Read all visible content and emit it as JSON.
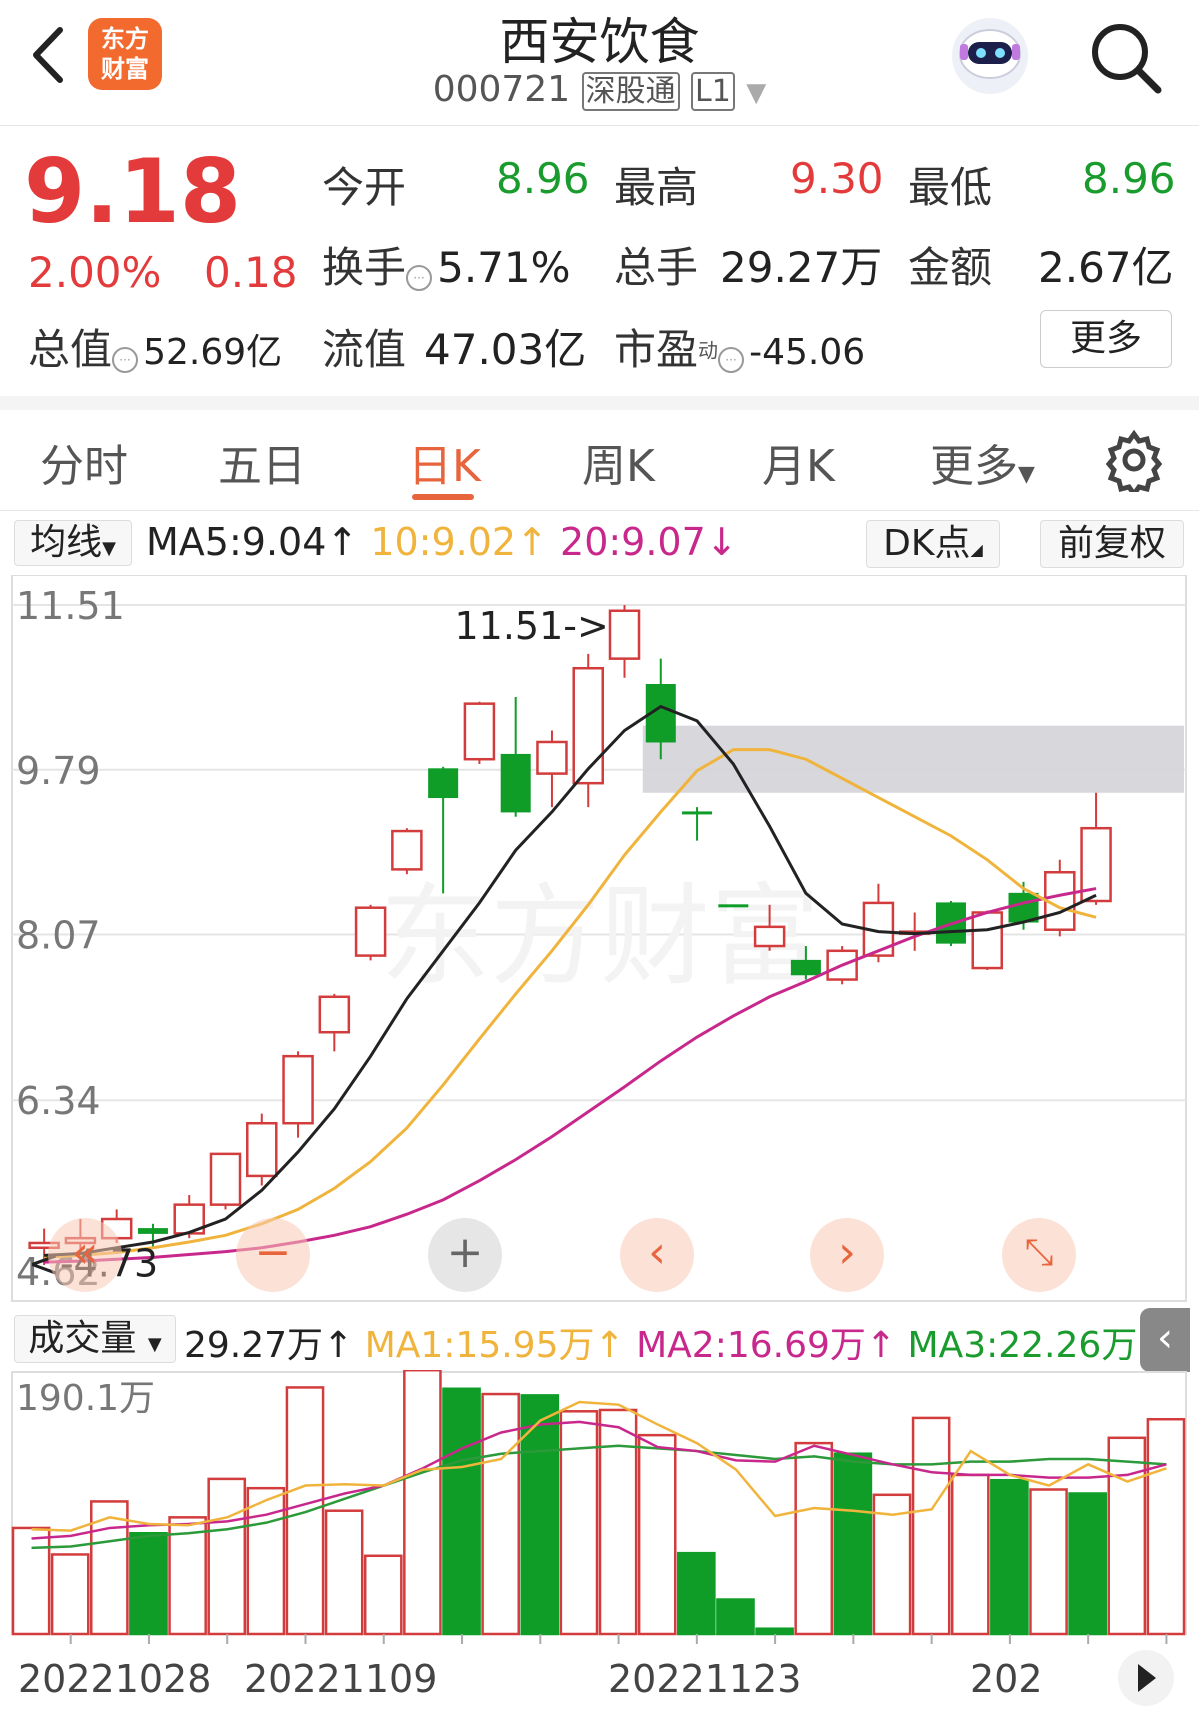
{
  "header": {
    "logo_line1": "东方",
    "logo_line2": "财富",
    "title": "西安饮食",
    "code": "000721",
    "tag1": "深股通",
    "tag2": "L1"
  },
  "quote": {
    "price": "9.18",
    "change_pct": "2.00%",
    "change": "0.18",
    "open_label": "今开",
    "open": "8.96",
    "high_label": "最高",
    "high": "9.30",
    "low_label": "最低",
    "low": "8.96",
    "turnover_label": "换手",
    "turnover": "5.71%",
    "volume_label": "总手",
    "volume": "29.27万",
    "amount_label": "金额",
    "amount": "2.67亿",
    "mktcap_label": "总值",
    "mktcap": "52.69亿",
    "float_label": "流值",
    "float_cap": "47.03亿",
    "pe_label": "市盈",
    "pe_sup": "动",
    "pe": "-45.06",
    "more_button": "更多"
  },
  "tabs": [
    "分时",
    "五日",
    "日K",
    "周K",
    "月K",
    "更多"
  ],
  "active_tab": "日K",
  "ma_bar": {
    "selector": "均线",
    "ma5": "MA5:9.04",
    "ma10": "10:9.02",
    "ma20": "20:9.07",
    "dk_button": "DK点",
    "fq_button": "前复权"
  },
  "vol_bar": {
    "selector": "成交量",
    "vol": "29.27万",
    "ma1": "MA1:15.95万",
    "ma2": "MA2:16.69万",
    "ma3": "MA3:22.26万"
  },
  "colors": {
    "up": "#d23c3c",
    "down": "#0f9d28",
    "ma5": "#222222",
    "ma10": "#f0b43c",
    "ma20": "#c8288c",
    "accent": "#e8643c"
  },
  "chart_data": {
    "type": "candlestick",
    "y_ticks": [
      "11.51",
      "9.79",
      "8.07",
      "6.34",
      "4.62"
    ],
    "ylim": [
      4.62,
      11.51
    ],
    "max_label": "11.51",
    "min_label": "4.73",
    "watermark": "东方财富",
    "candles": [
      {
        "o": 4.8,
        "c": 4.85,
        "h": 5.0,
        "l": 4.62,
        "dir": "up"
      },
      {
        "o": 4.85,
        "c": 4.9,
        "h": 5.1,
        "l": 4.78,
        "dir": "up"
      },
      {
        "o": 4.9,
        "c": 5.1,
        "h": 5.2,
        "l": 4.85,
        "dir": "up"
      },
      {
        "o": 5.0,
        "c": 4.95,
        "h": 5.05,
        "l": 4.8,
        "dir": "down"
      },
      {
        "o": 4.95,
        "c": 5.25,
        "h": 5.35,
        "l": 4.9,
        "dir": "up"
      },
      {
        "o": 5.25,
        "c": 5.78,
        "h": 5.78,
        "l": 5.2,
        "dir": "up"
      },
      {
        "o": 5.55,
        "c": 6.1,
        "h": 6.2,
        "l": 5.45,
        "dir": "up"
      },
      {
        "o": 6.1,
        "c": 6.8,
        "h": 6.85,
        "l": 5.95,
        "dir": "up"
      },
      {
        "o": 7.05,
        "c": 7.42,
        "h": 7.45,
        "l": 6.85,
        "dir": "up"
      },
      {
        "o": 7.85,
        "c": 8.35,
        "h": 8.38,
        "l": 7.8,
        "dir": "up"
      },
      {
        "o": 8.75,
        "c": 9.15,
        "h": 9.18,
        "l": 8.7,
        "dir": "up"
      },
      {
        "o": 9.8,
        "c": 9.5,
        "h": 9.82,
        "l": 8.5,
        "dir": "down"
      },
      {
        "o": 9.9,
        "c": 10.48,
        "h": 10.5,
        "l": 9.85,
        "dir": "up"
      },
      {
        "o": 9.95,
        "c": 9.35,
        "h": 10.55,
        "l": 9.3,
        "dir": "down"
      },
      {
        "o": 9.75,
        "c": 10.08,
        "h": 10.2,
        "l": 9.4,
        "dir": "up"
      },
      {
        "o": 9.65,
        "c": 10.85,
        "h": 11.0,
        "l": 9.4,
        "dir": "up"
      },
      {
        "o": 10.95,
        "c": 11.45,
        "h": 11.51,
        "l": 10.75,
        "dir": "up"
      },
      {
        "o": 10.68,
        "c": 10.08,
        "h": 10.95,
        "l": 9.9,
        "dir": "down"
      },
      {
        "o": 9.35,
        "c": 9.35,
        "h": 9.4,
        "l": 9.05,
        "dir": "down"
      },
      {
        "o": 8.38,
        "c": 8.38,
        "h": 8.38,
        "l": 8.38,
        "dir": "down"
      },
      {
        "o": 7.95,
        "c": 8.15,
        "h": 8.38,
        "l": 7.9,
        "dir": "up"
      },
      {
        "o": 7.8,
        "c": 7.65,
        "h": 7.95,
        "l": 7.6,
        "dir": "down"
      },
      {
        "o": 7.6,
        "c": 7.9,
        "h": 7.95,
        "l": 7.55,
        "dir": "up"
      },
      {
        "o": 7.85,
        "c": 8.4,
        "h": 8.6,
        "l": 7.78,
        "dir": "up"
      },
      {
        "o": 8.1,
        "c": 8.1,
        "h": 8.3,
        "l": 7.9,
        "dir": "up"
      },
      {
        "o": 8.4,
        "c": 7.98,
        "h": 8.42,
        "l": 7.95,
        "dir": "down"
      },
      {
        "o": 7.72,
        "c": 8.3,
        "h": 8.32,
        "l": 7.7,
        "dir": "up"
      },
      {
        "o": 8.5,
        "c": 8.2,
        "h": 8.62,
        "l": 8.12,
        "dir": "down"
      },
      {
        "o": 8.12,
        "c": 8.72,
        "h": 8.85,
        "l": 8.05,
        "dir": "up"
      },
      {
        "o": 8.42,
        "c": 9.18,
        "h": 9.55,
        "l": 8.38,
        "dir": "up"
      }
    ],
    "ma5": [
      4.72,
      4.74,
      4.8,
      4.86,
      4.96,
      5.1,
      5.4,
      5.8,
      6.25,
      6.8,
      7.4,
      7.9,
      8.4,
      8.95,
      9.35,
      9.8,
      10.2,
      10.45,
      10.3,
      9.85,
      9.2,
      8.5,
      8.18,
      8.1,
      8.08,
      8.1,
      8.12,
      8.2,
      8.3,
      8.48
    ],
    "ma10": [
      4.7,
      4.72,
      4.75,
      4.8,
      4.86,
      4.93,
      5.05,
      5.2,
      5.42,
      5.7,
      6.05,
      6.5,
      6.98,
      7.45,
      7.9,
      8.38,
      8.9,
      9.35,
      9.78,
      10.0,
      10.0,
      9.9,
      9.7,
      9.5,
      9.3,
      9.1,
      8.85,
      8.55,
      8.35,
      8.25
    ],
    "ma20": [
      4.65,
      4.66,
      4.68,
      4.7,
      4.73,
      4.76,
      4.8,
      4.86,
      4.93,
      5.02,
      5.15,
      5.3,
      5.5,
      5.72,
      5.96,
      6.22,
      6.48,
      6.75,
      7.0,
      7.22,
      7.42,
      7.58,
      7.75,
      7.9,
      8.05,
      8.18,
      8.3,
      8.4,
      8.48,
      8.55
    ],
    "shade_band": [
      9.55,
      10.25
    ],
    "volume_ylabel": "190.1万",
    "volumes": [
      80,
      60,
      100,
      76,
      88,
      117,
      110,
      186,
      93,
      59,
      199,
      185,
      181,
      180,
      168,
      169,
      150,
      61,
      26,
      4,
      144,
      136,
      105,
      163,
      120,
      116,
      109,
      106,
      148,
      162
    ],
    "vol_ma1": [
      79,
      78,
      88,
      83,
      82,
      88,
      101,
      112,
      113,
      112,
      124,
      126,
      132,
      161,
      175,
      173,
      158,
      144,
      124,
      89,
      95,
      93,
      90,
      94,
      138,
      120,
      112,
      128,
      115,
      125
    ],
    "vol_ma2": [
      72,
      74,
      80,
      82,
      83,
      85,
      90,
      98,
      106,
      112,
      125,
      140,
      152,
      158,
      160,
      156,
      141,
      138,
      131,
      130,
      142,
      135,
      128,
      122,
      120,
      120,
      118,
      118,
      120,
      128
    ],
    "vol_ma3": [
      65,
      66,
      70,
      74,
      76,
      79,
      84,
      92,
      102,
      112,
      122,
      131,
      136,
      138,
      140,
      142,
      140,
      138,
      135,
      132,
      134,
      130,
      128,
      128,
      130,
      130,
      132,
      132,
      130,
      128
    ],
    "x_labels": [
      "20221028",
      "20221109",
      "20221123",
      "202"
    ]
  }
}
